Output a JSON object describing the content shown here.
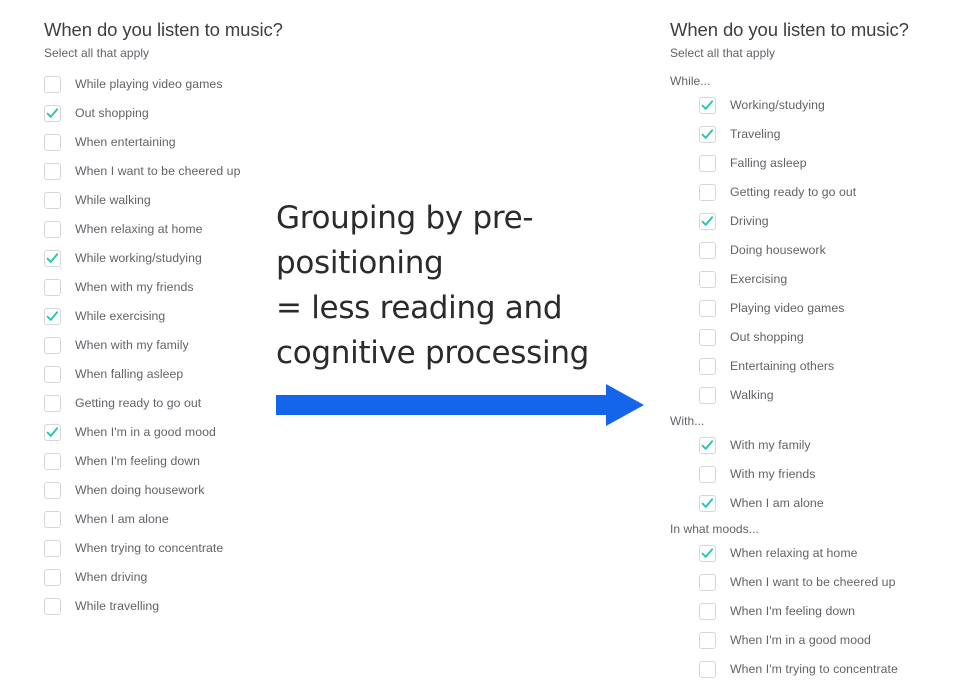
{
  "colors": {
    "check_teal": "#29c3b1",
    "arrow_blue": "#1565eb",
    "text_gray": "#5f6368",
    "title_gray": "#3c4043",
    "checkbox_border": "#d4d6d9"
  },
  "ungrouped": {
    "title": "When do you listen to music?",
    "subtitle": "Select all that apply",
    "options": [
      {
        "label": "While playing video games",
        "checked": false
      },
      {
        "label": "Out shopping",
        "checked": true
      },
      {
        "label": "When entertaining",
        "checked": false
      },
      {
        "label": "When I want to be cheered up",
        "checked": false
      },
      {
        "label": "While walking",
        "checked": false
      },
      {
        "label": "When relaxing at home",
        "checked": false
      },
      {
        "label": "While working/studying",
        "checked": true
      },
      {
        "label": "When with my friends",
        "checked": false
      },
      {
        "label": "While exercising",
        "checked": true
      },
      {
        "label": "When with my family",
        "checked": false
      },
      {
        "label": "When falling asleep",
        "checked": false
      },
      {
        "label": "Getting ready to go out",
        "checked": false
      },
      {
        "label": "When I'm in a good mood",
        "checked": true
      },
      {
        "label": "When I'm feeling down",
        "checked": false
      },
      {
        "label": "When doing housework",
        "checked": false
      },
      {
        "label": "When I am alone",
        "checked": false
      },
      {
        "label": "When trying to concentrate",
        "checked": false
      },
      {
        "label": "When driving",
        "checked": false
      },
      {
        "label": "While travelling",
        "checked": false
      }
    ]
  },
  "grouped": {
    "title": "When do you listen to music?",
    "subtitle": "Select all that apply",
    "groups": [
      {
        "header": "While...",
        "options": [
          {
            "label": "Working/studying",
            "checked": true
          },
          {
            "label": "Traveling",
            "checked": true
          },
          {
            "label": "Falling asleep",
            "checked": false
          },
          {
            "label": "Getting ready to go out",
            "checked": false
          },
          {
            "label": "Driving",
            "checked": true
          },
          {
            "label": "Doing housework",
            "checked": false
          },
          {
            "label": "Exercising",
            "checked": false
          },
          {
            "label": "Playing video games",
            "checked": false
          },
          {
            "label": "Out shopping",
            "checked": false
          },
          {
            "label": "Entertaining others",
            "checked": false
          },
          {
            "label": "Walking",
            "checked": false
          }
        ]
      },
      {
        "header": "With...",
        "options": [
          {
            "label": "With my family",
            "checked": true
          },
          {
            "label": "With my friends",
            "checked": false
          },
          {
            "label": "When I am alone",
            "checked": true
          }
        ]
      },
      {
        "header": "In what moods...",
        "options": [
          {
            "label": "When relaxing at home",
            "checked": true
          },
          {
            "label": "When I want to be cheered up",
            "checked": false
          },
          {
            "label": "When I'm feeling down",
            "checked": false
          },
          {
            "label": "When I'm in a good mood",
            "checked": false
          },
          {
            "label": "When I'm trying to concentrate",
            "checked": false
          }
        ]
      }
    ]
  },
  "callout": {
    "text": "Grouping by pre-positioning\n= less reading and\ncognitive processing",
    "arrow_direction": "right"
  }
}
